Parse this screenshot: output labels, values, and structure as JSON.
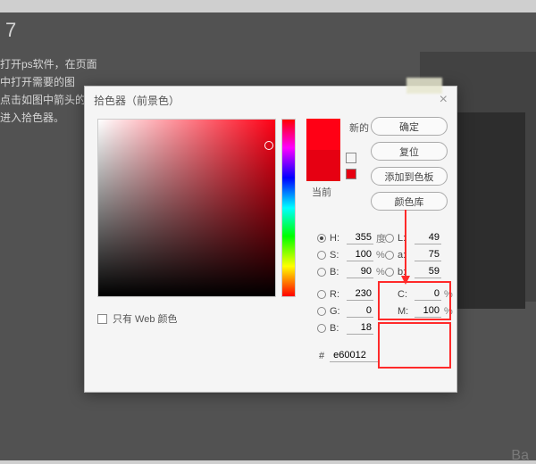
{
  "background": {
    "heading": "7",
    "line1": "打开ps软件，在页面中打开需要的图",
    "line2": "点击如图中箭头的",
    "line3": "进入拾色器。",
    "watermark": "Ba"
  },
  "dialog": {
    "title": "拾色器（前景色）",
    "swatch": {
      "new_label": "新的",
      "current_label": "当前"
    },
    "buttons": {
      "ok": "确定",
      "reset": "复位",
      "add": "添加到色板",
      "lib": "颜色库"
    },
    "hsb": {
      "h": {
        "label": "H:",
        "value": "355",
        "unit": "度"
      },
      "s": {
        "label": "S:",
        "value": "100",
        "unit": "%"
      },
      "b": {
        "label": "B:",
        "value": "90",
        "unit": "%"
      }
    },
    "rgb": {
      "r": {
        "label": "R:",
        "value": "230"
      },
      "g": {
        "label": "G:",
        "value": "0"
      },
      "b": {
        "label": "B:",
        "value": "18"
      }
    },
    "lab": {
      "l": {
        "label": "L:",
        "value": "49"
      },
      "a": {
        "label": "a:",
        "value": "75"
      },
      "b": {
        "label": "b:",
        "value": "59"
      }
    },
    "cmyk": {
      "c": {
        "label": "C:",
        "value": "0",
        "unit": "%"
      },
      "m": {
        "label": "M:",
        "value": "100",
        "unit": "%"
      }
    },
    "hex": {
      "label": "#",
      "value": "e60012"
    },
    "web_only": "只有 Web 颜色"
  }
}
